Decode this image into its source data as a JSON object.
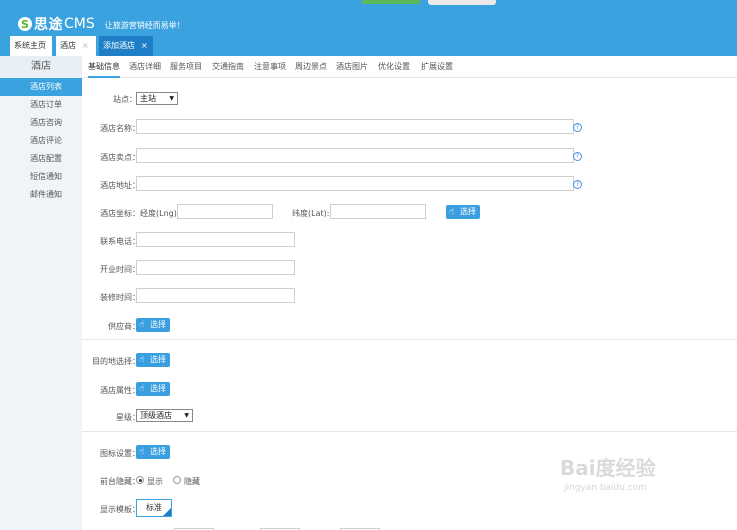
{
  "header": {
    "brand": "思途",
    "brand_suffix": "CMS",
    "slogan": "让旅游营销经而易举！"
  },
  "tabs": [
    {
      "label": "系统主页"
    },
    {
      "label": "酒店",
      "close": "×"
    },
    {
      "label": "添加酒店",
      "close": "×"
    }
  ],
  "sidebar": {
    "title": "酒店",
    "items": [
      {
        "label": "酒店列表",
        "active": true
      },
      {
        "label": "酒店订单"
      },
      {
        "label": "酒店咨询"
      },
      {
        "label": "酒店评论"
      },
      {
        "label": "酒店配置"
      },
      {
        "label": "短信通知"
      },
      {
        "label": "邮件通知"
      }
    ]
  },
  "subtabs": [
    "基础信息",
    "酒店详细",
    "服务项目",
    "交通指南",
    "注意事项",
    "周边景点",
    "酒店图片",
    "优化设置",
    "扩展设置"
  ],
  "form": {
    "site_label": "站点：",
    "site_value": "主站",
    "name_label": "酒店名称：",
    "selling_point_label": "酒店卖点：",
    "address_label": "酒店地址：",
    "coord_label": "酒店坐标：经度(Lng):",
    "lat_label": "纬度(Lat):",
    "phone_label": "联系电话：",
    "open_time_label": "开业时间：",
    "decor_time_label": "装修时间：",
    "supplier_label": "供应商：",
    "destination_label": "目的地选择：",
    "attribute_label": "酒店属性：",
    "star_label": "星级：",
    "star_value": "顶级酒店",
    "icon_label": "图标设置：",
    "frontend_hide_label": "前台隐藏：",
    "show_option": "显示",
    "hide_option": "隐藏",
    "template_label": "显示模板：",
    "template_value": "标准",
    "select_button": "选择",
    "help": "?"
  },
  "watermark": {
    "main": "Bai度经验",
    "sub": "jingyan.baidu.com"
  },
  "colors": {
    "header_bg": "#3aa2de",
    "active_tab": "#1e7fc6",
    "button": "#3a9fe0"
  }
}
